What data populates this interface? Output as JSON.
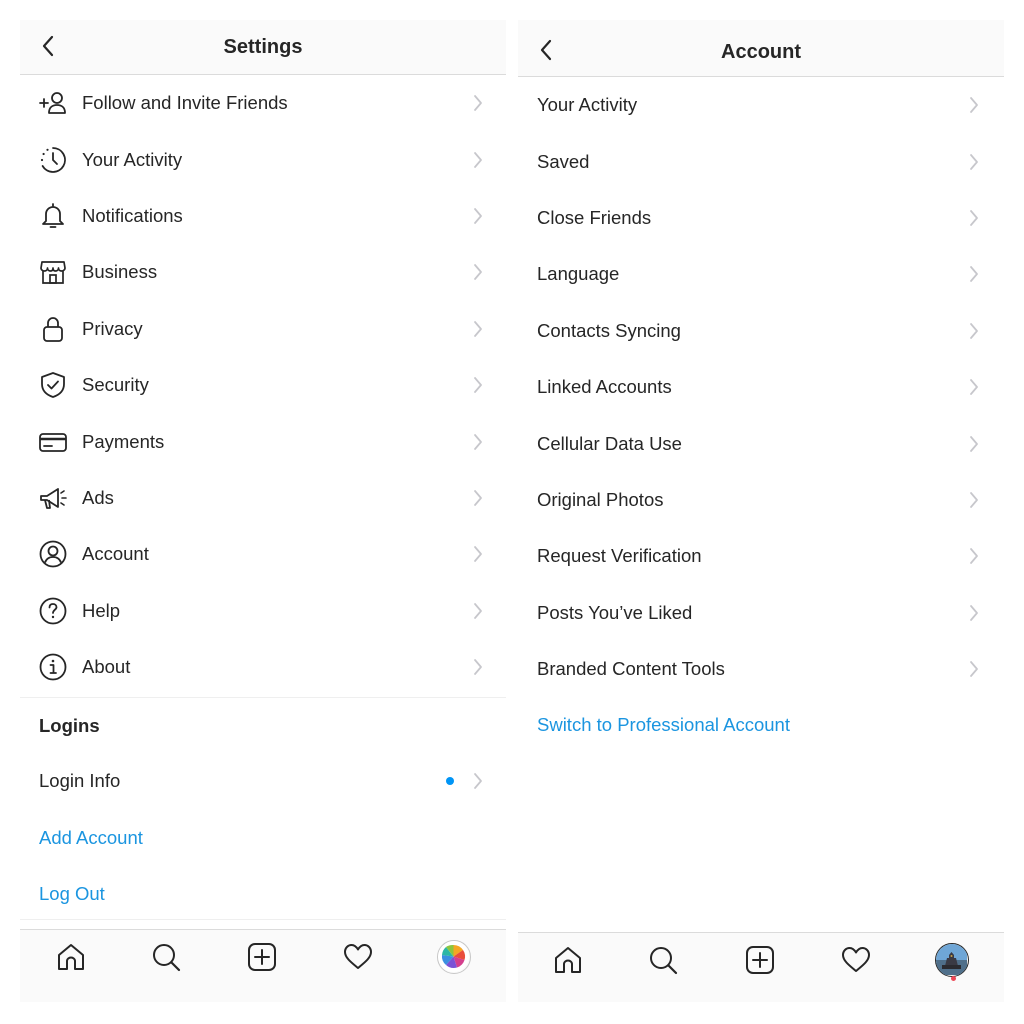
{
  "settings": {
    "title": "Settings",
    "items": [
      {
        "label": "Follow and Invite Friends",
        "icon": "add-person-icon"
      },
      {
        "label": "Your Activity",
        "icon": "activity-clock-icon"
      },
      {
        "label": "Notifications",
        "icon": "bell-icon"
      },
      {
        "label": "Business",
        "icon": "storefront-icon"
      },
      {
        "label": "Privacy",
        "icon": "lock-icon"
      },
      {
        "label": "Security",
        "icon": "shield-check-icon"
      },
      {
        "label": "Payments",
        "icon": "credit-card-icon"
      },
      {
        "label": "Ads",
        "icon": "megaphone-icon"
      },
      {
        "label": "Account",
        "icon": "account-circle-icon"
      },
      {
        "label": "Help",
        "icon": "help-circle-icon"
      },
      {
        "label": "About",
        "icon": "info-circle-icon"
      }
    ],
    "logins": {
      "title": "Logins",
      "login_info": "Login Info",
      "add_account": "Add Account",
      "log_out": "Log Out"
    }
  },
  "account": {
    "title": "Account",
    "items": [
      {
        "label": "Your Activity"
      },
      {
        "label": "Saved"
      },
      {
        "label": "Close Friends"
      },
      {
        "label": "Language"
      },
      {
        "label": "Contacts Syncing"
      },
      {
        "label": "Linked Accounts"
      },
      {
        "label": "Cellular Data Use"
      },
      {
        "label": "Original Photos"
      },
      {
        "label": "Request Verification"
      },
      {
        "label": "Posts You’ve Liked"
      },
      {
        "label": "Branded Content Tools"
      }
    ],
    "switch_link": "Switch to Professional Account"
  },
  "tabbar": {
    "tabs": [
      "home-icon",
      "search-icon",
      "new-post-icon",
      "heart-icon",
      "profile-avatar"
    ]
  },
  "colors": {
    "link": "#1b95e0",
    "text": "#262626",
    "chevron": "#c7c7cc",
    "divider": "#dbdbdb",
    "unread_dot": "#0095f6"
  }
}
